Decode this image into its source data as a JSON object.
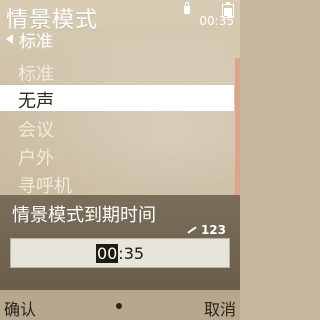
{
  "header": {
    "title": "情景模式",
    "subtitle": "标准",
    "clock": "00:35"
  },
  "profiles": [
    {
      "label": "标准",
      "selected": false
    },
    {
      "label": "无声",
      "selected": true
    },
    {
      "label": "会议",
      "selected": false
    },
    {
      "label": "户外",
      "selected": false
    },
    {
      "label": "寻呼机",
      "selected": false
    }
  ],
  "dialog": {
    "title": "情景模式到期时间",
    "input_mode": "123",
    "time_hours": "00",
    "time_rest": ":35"
  },
  "softkeys": {
    "left": "确认",
    "right": "取消"
  }
}
